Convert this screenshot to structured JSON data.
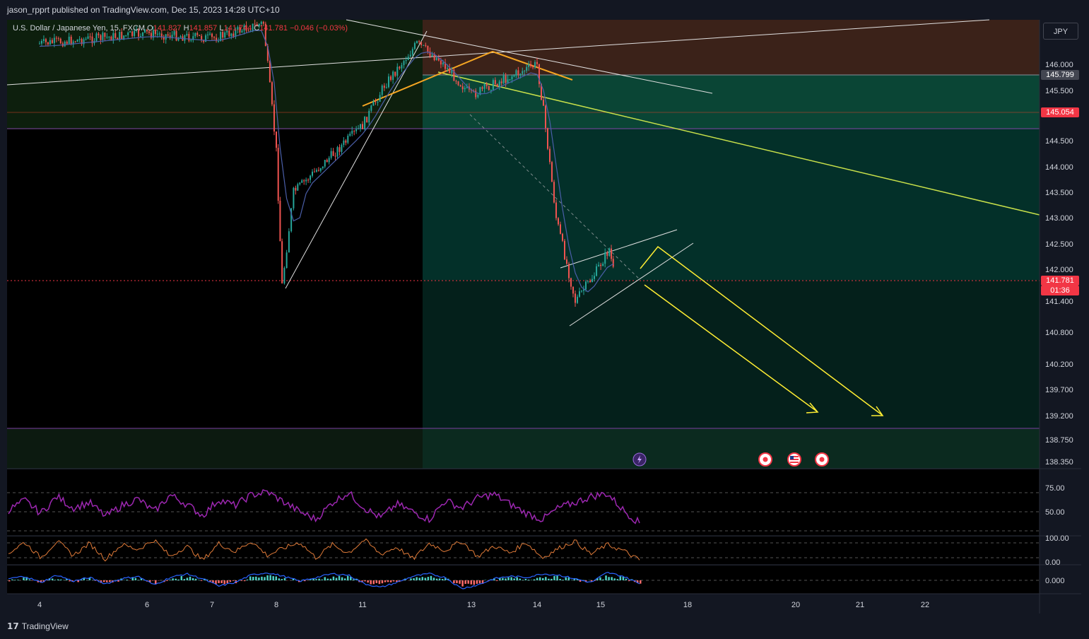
{
  "header": {
    "published_by": "jason_rpprt published on TradingView.com, Dec 15, 2023 14:28 UTC+10"
  },
  "legend": {
    "symbol": "U.S. Dollar / Japanese Yen, 15, FXCM",
    "open_label": "O",
    "open": "141.827",
    "high_label": "H",
    "high": "141.857",
    "low_label": "L",
    "low": "141.744",
    "close_label": "C",
    "close": "141.781",
    "change": "−0.046 (−0.03%)"
  },
  "currency_button": "JPY",
  "tags": {
    "upper_zone": "145.799",
    "mid_line": "145.054",
    "current_price": "141.781",
    "countdown": "01:36"
  },
  "footer": {
    "brand": "TradingView"
  },
  "colors": {
    "background": "#131722",
    "bull": "#26a69a",
    "bear": "#ef5350",
    "pattern_line": "#f5a623",
    "projection": "#ffee33",
    "trendline_green": "#c8e04a",
    "rsi": "#9c27b0",
    "current_price": "#f23645"
  },
  "chart_data": [
    {
      "type": "candlestick",
      "symbol": "USDJPY",
      "timeframe": "15",
      "y_axis_ticks": [
        146.0,
        145.5,
        144.5,
        144.0,
        143.5,
        143.0,
        142.5,
        142.0,
        141.4,
        140.8,
        140.2,
        139.7,
        139.2,
        138.75,
        138.35
      ],
      "y_axis_labels": [
        "146.000",
        "145.500",
        "144.500",
        "144.000",
        "143.500",
        "143.000",
        "142.500",
        "142.000",
        "141.400",
        "140.800",
        "140.200",
        "139.700",
        "139.200",
        "138.750",
        "138.350"
      ],
      "ylim": [
        138.05,
        146.9
      ],
      "x_axis_labels": [
        "4",
        "6",
        "7",
        "8",
        "11",
        "13",
        "14",
        "15",
        "18",
        "20",
        "21",
        "22"
      ],
      "price_path": [
        {
          "x": "4",
          "price": 146.4
        },
        {
          "x": "6",
          "price": 146.6
        },
        {
          "x": "7",
          "price": 146.5
        },
        {
          "x": "7.8",
          "price": 146.8
        },
        {
          "x": "8",
          "price": 144.3
        },
        {
          "x": "8.2",
          "price": 141.7
        },
        {
          "x": "8.6",
          "price": 143.5
        },
        {
          "x": "11",
          "price": 144.8
        },
        {
          "x": "11.4",
          "price": 145.6
        },
        {
          "x": "12",
          "price": 146.4
        },
        {
          "x": "12.4",
          "price": 146.1
        },
        {
          "x": "13",
          "price": 145.4
        },
        {
          "x": "13.3",
          "price": 145.6
        },
        {
          "x": "14",
          "price": 146.0
        },
        {
          "x": "14.1",
          "price": 145.1
        },
        {
          "x": "14.3",
          "price": 143.0
        },
        {
          "x": "14.6",
          "price": 141.4
        },
        {
          "x": "14.9",
          "price": 141.9
        },
        {
          "x": "15.3",
          "price": 142.4
        },
        {
          "x": "15.5",
          "price": 141.78
        }
      ],
      "zones": [
        {
          "name": "supply",
          "from": 145.8,
          "to": 146.9
        },
        {
          "name": "demand",
          "from": 138.35,
          "to": 145.8
        }
      ],
      "horizontal_lines": [
        145.799,
        145.054,
        144.75,
        141.781,
        138.95
      ],
      "projection_arrows": [
        {
          "from_price": 141.75,
          "to_price": 139.25,
          "x_from": "15.5",
          "x_to": "20.3"
        },
        {
          "from_price": 142.4,
          "to_price": 139.2,
          "x_from": "15.8",
          "x_to": "21.4"
        }
      ]
    },
    {
      "type": "line",
      "name": "RSI",
      "y_axis_labels": [
        "75.00",
        "50.00"
      ],
      "ylim": [
        0,
        100
      ],
      "series": [
        {
          "values": [
            52,
            65,
            48,
            70,
            55,
            62,
            44,
            58,
            67,
            50,
            72,
            60,
            45,
            66,
            58,
            72,
            76,
            63,
            50,
            40,
            62,
            75,
            55,
            42,
            60,
            50,
            40,
            65,
            55,
            68,
            73,
            60,
            48,
            40,
            55,
            62,
            70,
            74,
            52,
            35
          ]
        }
      ]
    },
    {
      "type": "line",
      "name": "Stochastic",
      "y_axis_labels": [
        "100.00",
        "0.00"
      ],
      "ylim": [
        0,
        100
      ],
      "series": [
        {
          "values": [
            40,
            85,
            20,
            90,
            30,
            80,
            15,
            75,
            55,
            95,
            25,
            70,
            10,
            80,
            45,
            90,
            30,
            60,
            85,
            20,
            75,
            40,
            95,
            35,
            65,
            15,
            80,
            50,
            90,
            25,
            70,
            40,
            85,
            20,
            60,
            90,
            35,
            75,
            50,
            10
          ]
        }
      ]
    },
    {
      "type": "line",
      "name": "MACD",
      "y_axis_labels": [
        "0.000"
      ],
      "ylim": [
        -1,
        1
      ],
      "series": [
        {
          "values": [
            0.1,
            0.3,
            -0.2,
            0.4,
            -0.1,
            0.2,
            -0.3,
            0.1,
            0.3,
            -0.4,
            0.2,
            0.5,
            0.1,
            -0.5,
            -0.2,
            0.4,
            0.6,
            0.3,
            -0.1,
            0.2,
            0.5,
            0.4,
            -0.3,
            -0.6,
            -0.2,
            0.3,
            0.5,
            0.2,
            -0.7,
            -0.4,
            0.1,
            0.3,
            0.2,
            0.5,
            0.4,
            0.1,
            -0.2,
            0.6,
            0.3,
            -0.3
          ]
        }
      ]
    }
  ]
}
